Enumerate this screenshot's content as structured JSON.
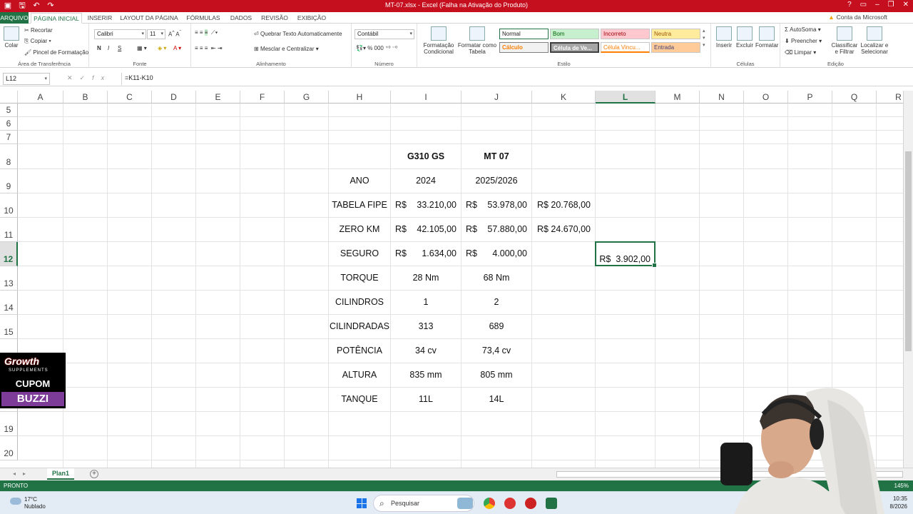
{
  "window": {
    "title": "MT-07.xlsx - Excel (Falha na Ativação do Produto)"
  },
  "tabs": [
    {
      "label": "ARQUIVO"
    },
    {
      "label": "PÁGINA INICIAL"
    },
    {
      "label": "INSERIR"
    },
    {
      "label": "LAYOUT DA PÁGINA"
    },
    {
      "label": "FÓRMULAS"
    },
    {
      "label": "DADOS"
    },
    {
      "label": "REVISÃO"
    },
    {
      "label": "EXIBIÇÃO"
    }
  ],
  "account": "Conta da Microsoft",
  "ribbon": {
    "clipboard": {
      "paste": "Colar",
      "cut": "Recortar",
      "copy": "Copiar",
      "painter": "Pincel de Formatação",
      "label": "Área de Transferência"
    },
    "font": {
      "name": "Calibri",
      "size": "11",
      "bold": "N",
      "italic": "I",
      "underline": "S",
      "label": "Fonte"
    },
    "alignment": {
      "wrap": "Quebrar Texto Automaticamente",
      "merge": "Mesclar e Centralizar",
      "label": "Alinhamento"
    },
    "number": {
      "format": "Contábil",
      "label": "Número"
    },
    "styles": {
      "conditional": "Formatação Condicional",
      "as_table": "Formatar como Tabela",
      "cells": [
        "Normal",
        "Bom",
        "Incorreto",
        "Neutra",
        "Cálculo",
        "Célula de Ve...",
        "Célula Vincu...",
        "Entrada"
      ],
      "label": "Estilo"
    },
    "cells": {
      "insert": "Inserir",
      "delete": "Excluir",
      "format": "Formatar",
      "label": "Células"
    },
    "editing": {
      "autosum": "AutoSoma",
      "fill": "Preencher",
      "clear": "Limpar",
      "sort": "Classificar e Filtrar",
      "find": "Localizar e Selecionar",
      "label": "Edição"
    }
  },
  "formula_bar": {
    "name_box": "L12",
    "formula": "=K11-K10"
  },
  "columns": [
    "A",
    "B",
    "C",
    "D",
    "E",
    "F",
    "G",
    "H",
    "I",
    "J",
    "K",
    "L",
    "M",
    "N",
    "O",
    "P",
    "Q",
    "R"
  ],
  "rows": [
    "5",
    "6",
    "7",
    "8",
    "9",
    "10",
    "11",
    "12",
    "13",
    "14",
    "15",
    "19",
    "20"
  ],
  "table": {
    "headers": {
      "i": "G310 GS",
      "j": "MT 07"
    },
    "ano": {
      "label": "ANO",
      "i": "2024",
      "j": "2025/2026"
    },
    "fipe": {
      "label": "TABELA FIPE",
      "i": "33.210,00",
      "j": "53.978,00",
      "k": "R$ 20.768,00"
    },
    "zero": {
      "label": "ZERO KM",
      "i": "42.105,00",
      "j": "57.880,00",
      "k": "R$ 24.670,00"
    },
    "seguro": {
      "label": "SEGURO",
      "i": "1.634,00",
      "j": "4.000,00",
      "l": "R$  3.902,00"
    },
    "torque": {
      "label": "TORQUE",
      "i": "28 Nm",
      "j": "68 Nm"
    },
    "cilindros": {
      "label": "CILINDROS",
      "i": "1",
      "j": "2"
    },
    "cilindradas": {
      "label": "CILINDRADAS",
      "i": "313",
      "j": "689"
    },
    "potencia": {
      "label": "POTÊNCIA",
      "i": "34 cv",
      "j": "73,4 cv"
    },
    "altura": {
      "label": "ALTURA",
      "i": "835 mm",
      "j": "805 mm"
    },
    "tanque": {
      "label": "TANQUE",
      "i": "11L",
      "j": "14L"
    },
    "currency": "R$"
  },
  "sheet": {
    "name": "Plan1"
  },
  "status": {
    "ready": "PRONTO",
    "zoom": "145%"
  },
  "taskbar": {
    "temp": "17°C",
    "weather": "Nublado",
    "search": "Pesquisar",
    "time": "10:35",
    "date": "8/2026"
  },
  "overlay": {
    "brand": "Growth",
    "sub": "SUPPLEMENTS",
    "coupon": "CUPOM",
    "code": "BUZZI"
  },
  "colors": {
    "excel_green": "#217346",
    "title_red": "#c50f1f"
  }
}
